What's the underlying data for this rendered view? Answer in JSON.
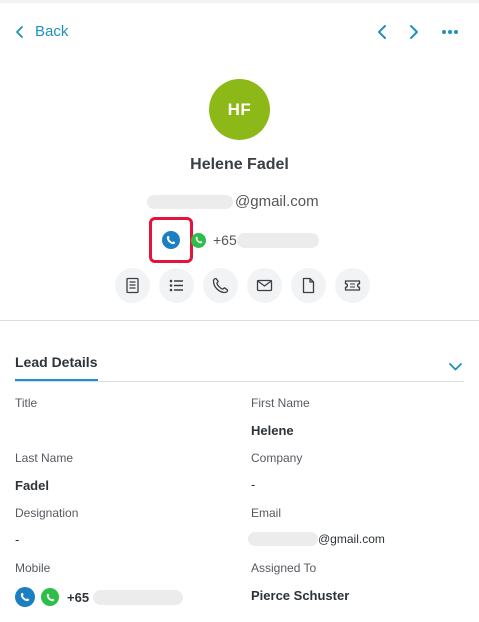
{
  "header": {
    "back_label": "Back"
  },
  "contact": {
    "initials": "HF",
    "avatar_color": "#8cb918",
    "name": "Helene Fadel",
    "email_suffix": "@gmail.com",
    "phone_prefix": "+65"
  },
  "quick_actions": [
    {
      "icon": "notes-icon"
    },
    {
      "icon": "list-icon"
    },
    {
      "icon": "phone-icon"
    },
    {
      "icon": "mail-icon"
    },
    {
      "icon": "document-icon"
    },
    {
      "icon": "ticket-icon"
    }
  ],
  "lead_details": {
    "section_title": "Lead Details",
    "title_label": "Title",
    "first_name_label": "First Name",
    "first_name_value": "Helene",
    "last_name_label": "Last Name",
    "last_name_value": "Fadel",
    "company_label": "Company",
    "company_value": "-",
    "designation_label": "Designation",
    "designation_value": "-",
    "email_label": "Email",
    "email_value_suffix": "@gmail.com",
    "mobile_label": "Mobile",
    "mobile_value_prefix": "+65",
    "assigned_to_label": "Assigned To",
    "assigned_to_value": "Pierce Schuster"
  },
  "colors": {
    "accent": "#1f8fc4",
    "call_blue": "#1b7fc2",
    "whatsapp_green": "#2fbd4a",
    "highlight_red": "#e0143c"
  }
}
